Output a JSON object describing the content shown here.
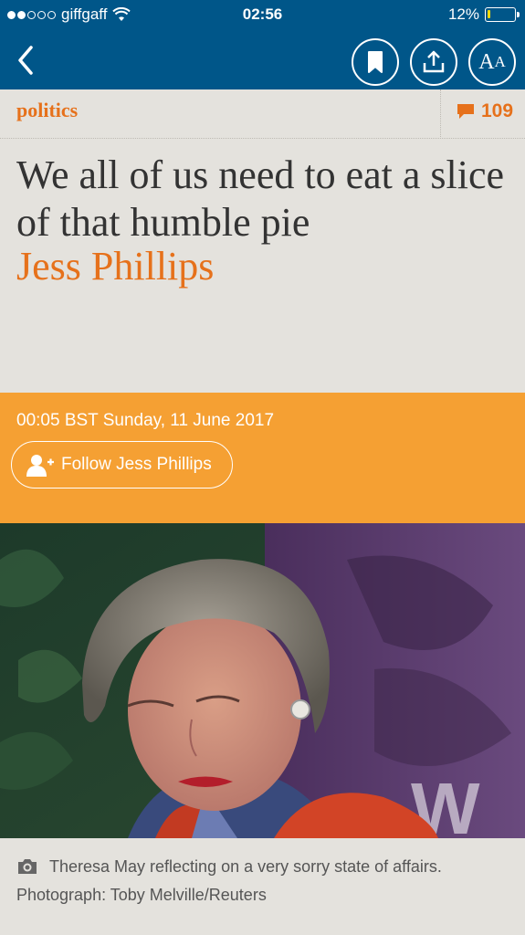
{
  "status_bar": {
    "carrier": "giffgaff",
    "time": "02:56",
    "battery_percent": "12%",
    "battery_level": 0.12,
    "signal_bars_filled": 2,
    "signal_bars_total": 5
  },
  "nav": {
    "back_icon": "chevron-left-icon",
    "bookmark_icon": "bookmark-icon",
    "share_icon": "share-icon",
    "text_size_label_big": "A",
    "text_size_label_small": "A"
  },
  "article": {
    "section": "politics",
    "comment_count": "109",
    "headline": "We all of us need to eat a slice of that humble pie",
    "byline": "Jess Phillips",
    "dateline": "00:05 BST Sunday, 11 June 2017",
    "follow_label": "Follow Jess Phillips",
    "caption": "Theresa May reflecting on a very sorry state of affairs. Photograph: Toby Melville/Reuters"
  },
  "colors": {
    "brand_blue": "#005689",
    "accent_orange": "#e6711b",
    "meta_orange": "#f5a033",
    "page_bg": "#e4e2dd"
  }
}
